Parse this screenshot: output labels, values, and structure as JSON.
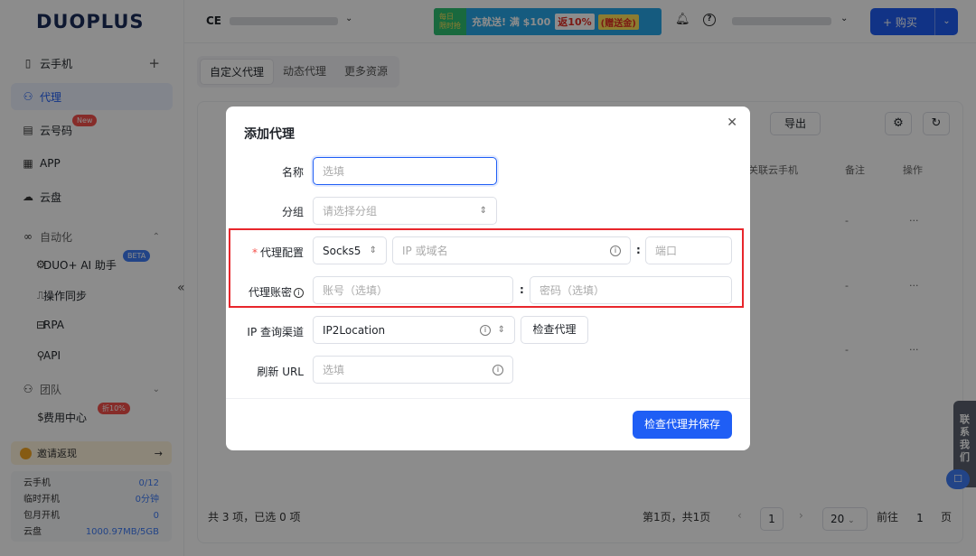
{
  "brand": {
    "logo": "DUOPLUS"
  },
  "sidebar": {
    "items": [
      {
        "label": "云手机",
        "icon": "phone-icon"
      },
      {
        "label": "代理",
        "icon": "proxy-icon"
      },
      {
        "label": "云号码",
        "icon": "sim-icon",
        "badge": "New"
      },
      {
        "label": "APP",
        "icon": "grid-icon"
      },
      {
        "label": "云盘",
        "icon": "cloud-icon"
      }
    ],
    "automation": {
      "label": "自动化",
      "icon": "automation-icon"
    },
    "automation_items": [
      {
        "label": "DUO+ AI 助手",
        "badge": "BETA"
      },
      {
        "label": "操作同步"
      },
      {
        "label": "RPA"
      },
      {
        "label": "API"
      }
    ],
    "team": {
      "label": "团队",
      "icon": "team-icon"
    },
    "billing": {
      "label": "费用中心",
      "badge": "折10%"
    },
    "invite": {
      "label": "邀请返现",
      "arrow": "→"
    },
    "usage": [
      {
        "label": "云手机",
        "value": "0/12"
      },
      {
        "label": "临时开机",
        "value": "0分钟"
      },
      {
        "label": "包月开机",
        "value": "0"
      },
      {
        "label": "云盘",
        "value": "1000.97MB/5GB"
      }
    ],
    "collapse": "«"
  },
  "topbar": {
    "workspace": "CE",
    "promo": {
      "left_line1": "每日",
      "left_line2": "限时抢",
      "text": "充就送! 满 $100",
      "discount": "返10%",
      "gift": "(赠送金)"
    },
    "buy_label": "+ 购买"
  },
  "tabs": [
    {
      "label": "自定义代理",
      "active": true
    },
    {
      "label": "动态代理",
      "active": false
    },
    {
      "label": "更多资源",
      "active": false
    }
  ],
  "table": {
    "export_label": "导出",
    "headers": [
      "关联云手机",
      "备注",
      "操作"
    ],
    "row_placeholders": [
      "-",
      "-",
      "···"
    ],
    "footer_total": "共 3 项，已选 0 项",
    "page_text": "第1页，共1页",
    "current_page": "1",
    "page_size": "20",
    "goto_label": "前往",
    "goto_value": "1",
    "page_unit": "页"
  },
  "float_contact": {
    "label": "联系我们"
  },
  "modal": {
    "title": "添加代理",
    "fields": {
      "name": {
        "label": "名称",
        "placeholder": "选填"
      },
      "group": {
        "label": "分组",
        "placeholder": "请选择分组"
      },
      "proxy_config": {
        "label": "代理配置",
        "protocol": "Socks5",
        "host_placeholder": "IP 或域名",
        "port_placeholder": "端口"
      },
      "proxy_account": {
        "label": "代理账密",
        "user_placeholder": "账号（选填）",
        "pass_placeholder": "密码（选填）"
      },
      "ip_channel": {
        "label": "IP 查询渠道",
        "value": "IP2Location",
        "check_label": "检查代理"
      },
      "refresh_url": {
        "label": "刷新 URL",
        "placeholder": "选填"
      }
    },
    "save_label": "检查代理并保存"
  },
  "colors": {
    "primary": "#1f5ef5",
    "highlight_border": "#e8262c",
    "required": "#f5514b"
  }
}
